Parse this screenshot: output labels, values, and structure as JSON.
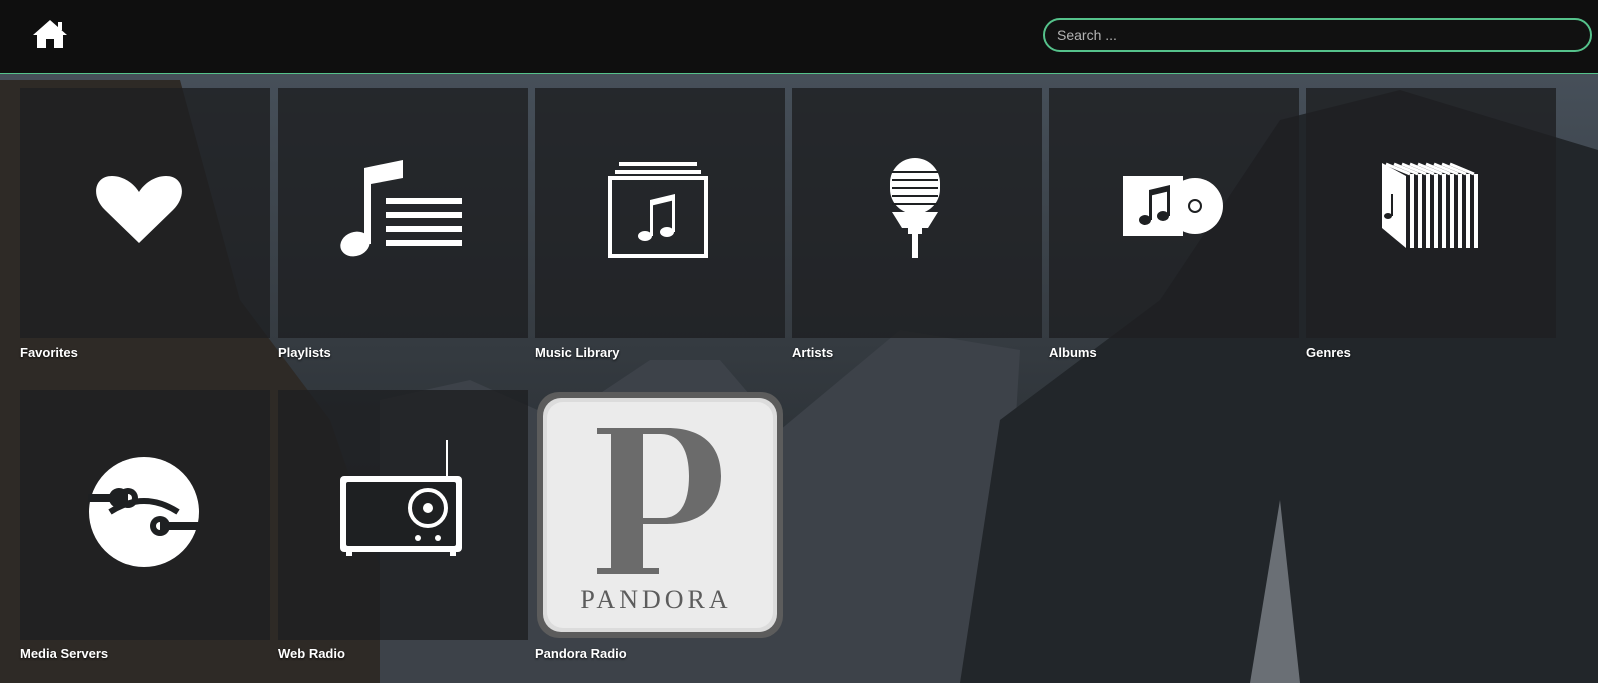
{
  "header": {
    "home_icon": "home-icon",
    "search": {
      "placeholder": "Search ...",
      "value": ""
    }
  },
  "tiles": [
    {
      "label": "Favorites",
      "icon": "heart-icon"
    },
    {
      "label": "Playlists",
      "icon": "playlist-icon"
    },
    {
      "label": "Music Library",
      "icon": "music-library-icon"
    },
    {
      "label": "Artists",
      "icon": "microphone-icon"
    },
    {
      "label": "Albums",
      "icon": "album-icon"
    },
    {
      "label": "Genres",
      "icon": "genres-icon"
    },
    {
      "label": "Media Servers",
      "icon": "media-server-icon"
    },
    {
      "label": "Web Radio",
      "icon": "radio-icon"
    },
    {
      "label": "Pandora Radio",
      "icon": "pandora-icon",
      "logo_text": "PANDORA"
    }
  ],
  "colors": {
    "accent": "#55c28b",
    "header_bg": "#0f0f0f",
    "tile_bg": "#1e2022"
  }
}
